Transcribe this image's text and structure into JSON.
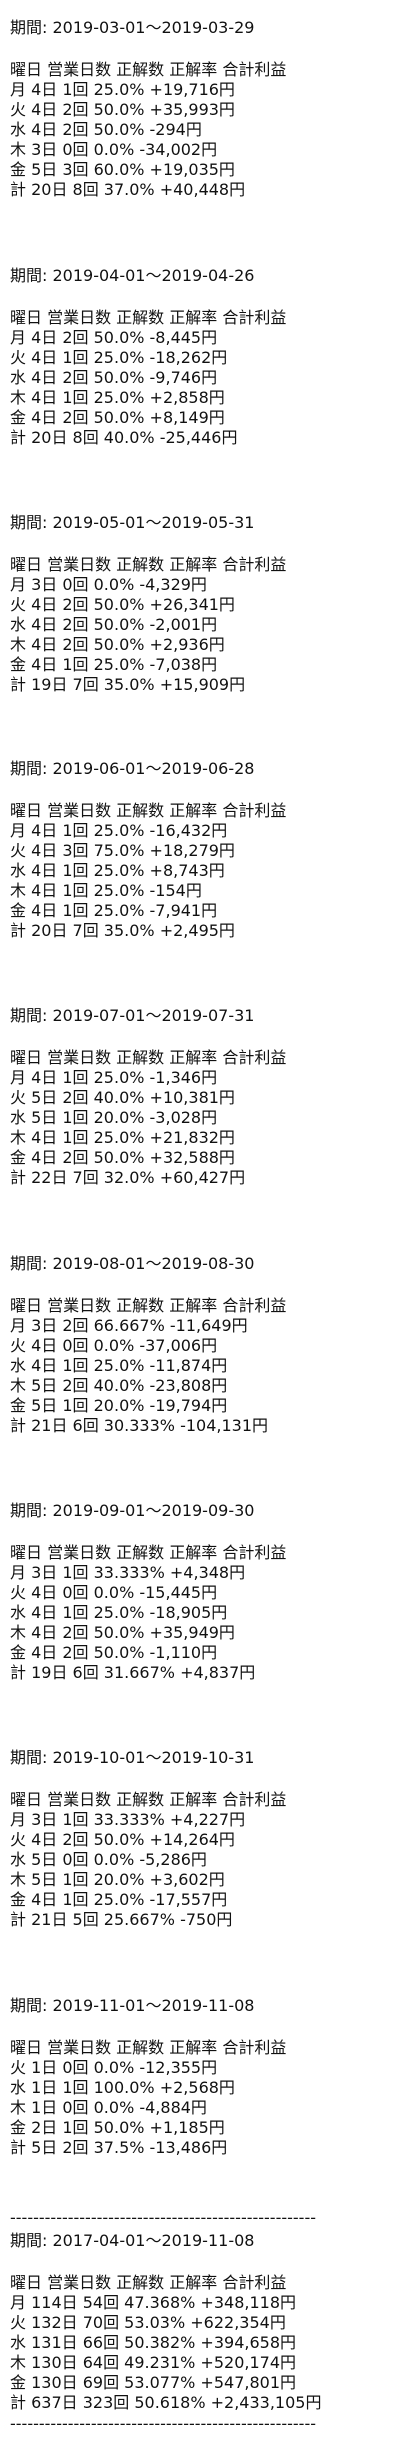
{
  "header_line": "曜日 営業日数 正解数 正解率 合計利益",
  "divider": "-----------------------------------------------------",
  "sections": [
    {
      "period": "期間: 2019-03-01～2019-03-29",
      "rows": [
        "月 4日 1回 25.0% +19,716円",
        "火 4日 2回 50.0% +35,993円",
        "水 4日 2回 50.0% -294円",
        "木 3日 0回 0.0% -34,002円",
        "金 5日 3回 60.0% +19,035円",
        "計 20日 8回 37.0% +40,448円"
      ]
    },
    {
      "period": "期間: 2019-04-01～2019-04-26",
      "rows": [
        "月 4日 2回 50.0% -8,445円",
        "火 4日 1回 25.0% -18,262円",
        "水 4日 2回 50.0% -9,746円",
        "木 4日 1回 25.0% +2,858円",
        "金 4日 2回 50.0% +8,149円",
        "計 20日 8回 40.0% -25,446円"
      ]
    },
    {
      "period": "期間: 2019-05-01～2019-05-31",
      "rows": [
        "月 3日 0回 0.0% -4,329円",
        "火 4日 2回 50.0% +26,341円",
        "水 4日 2回 50.0% -2,001円",
        "木 4日 2回 50.0% +2,936円",
        "金 4日 1回 25.0% -7,038円",
        "計 19日 7回 35.0% +15,909円"
      ]
    },
    {
      "period": "期間: 2019-06-01～2019-06-28",
      "rows": [
        "月 4日 1回 25.0% -16,432円",
        "火 4日 3回 75.0% +18,279円",
        "水 4日 1回 25.0% +8,743円",
        "木 4日 1回 25.0% -154円",
        "金 4日 1回 25.0% -7,941円",
        "計 20日 7回 35.0% +2,495円"
      ]
    },
    {
      "period": "期間: 2019-07-01～2019-07-31",
      "rows": [
        "月 4日 1回 25.0% -1,346円",
        "火 5日 2回 40.0% +10,381円",
        "水 5日 1回 20.0% -3,028円",
        "木 4日 1回 25.0% +21,832円",
        "金 4日 2回 50.0% +32,588円",
        "計 22日 7回 32.0% +60,427円"
      ]
    },
    {
      "period": "期間: 2019-08-01～2019-08-30",
      "rows": [
        "月 3日 2回 66.667% -11,649円",
        "火 4日 0回 0.0% -37,006円",
        "水 4日 1回 25.0% -11,874円",
        "木 5日 2回 40.0% -23,808円",
        "金 5日 1回 20.0% -19,794円",
        "計 21日 6回 30.333% -104,131円"
      ]
    },
    {
      "period": "期間: 2019-09-01～2019-09-30",
      "rows": [
        "月 3日 1回 33.333% +4,348円",
        "火 4日 0回 0.0% -15,445円",
        "水 4日 1回 25.0% -18,905円",
        "木 4日 2回 50.0% +35,949円",
        "金 4日 2回 50.0% -1,110円",
        "計 19日 6回 31.667% +4,837円"
      ]
    },
    {
      "period": "期間: 2019-10-01～2019-10-31",
      "rows": [
        "月 3日 1回 33.333% +4,227円",
        "火 4日 2回 50.0% +14,264円",
        "水 5日 0回 0.0% -5,286円",
        "木 5日 1回 20.0% +3,602円",
        "金 4日 1回 25.0% -17,557円",
        "計 21日 5回 25.667% -750円"
      ]
    },
    {
      "period": "期間: 2019-11-01～2019-11-08",
      "rows": [
        "火 1日 0回 0.0% -12,355円",
        "水 1日 1回 100.0% +2,568円",
        "木 1日 0回 0.0% -4,884円",
        "金 2日 1回 50.0% +1,185円",
        "計 5日 2回 37.5% -13,486円"
      ]
    },
    {
      "period": "期間: 2017-04-01～2019-11-08",
      "rows": [
        "月 114日 54回 47.368% +348,118円",
        "火 132日 70回 53.03% +622,354円",
        "水 131日 66回 50.382% +394,658円",
        "木 130日 64回 49.231% +520,174円",
        "金 130日 69回 53.077% +547,801円",
        "計 637日 323回 50.618% +2,433,105円"
      ]
    }
  ]
}
